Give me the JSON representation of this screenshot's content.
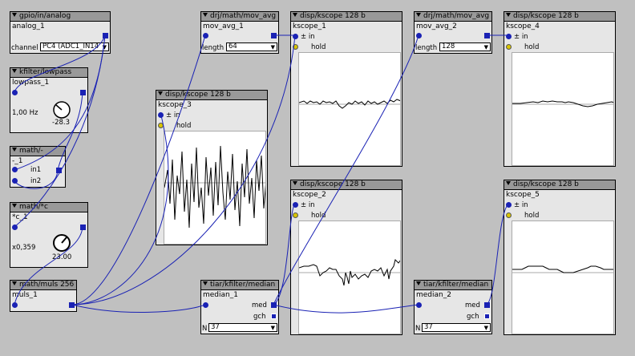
{
  "colors": {
    "background": "#c0c0c0",
    "object": "#e6e6e6",
    "header": "#999999",
    "wire": "#1a22b4",
    "bang": "#d8c400"
  },
  "gpio": {
    "title": "gpio/in/analog",
    "instance": "analog_1",
    "channel_label": "channel",
    "channel_value": "PC4 (ADC1_IN14"
  },
  "lowpass": {
    "title": "kfilter/lowpass",
    "instance": "lowpass_1",
    "value": "1,00 Hz",
    "knob_value": "-28.3"
  },
  "minus": {
    "title": "math/-",
    "instance": "-_1",
    "in1": "in1",
    "in2": "in2"
  },
  "mulc": {
    "title": "math/*c",
    "instance": "*c_1",
    "value": "x0,359",
    "knob_value": "23.00"
  },
  "muls": {
    "title": "math/muls 256",
    "instance": "muls_1"
  },
  "kscope3": {
    "title": "disp/kscope 128 b",
    "instance": "kscope_3",
    "in": "± in",
    "hold": "hold"
  },
  "movavg1": {
    "title": "drj/math/mov_avg",
    "instance": "mov_avg_1",
    "length_label": "length",
    "length_value": "64"
  },
  "kscope1": {
    "title": "disp/kscope 128 b",
    "instance": "kscope_1",
    "in": "± in",
    "hold": "hold"
  },
  "kscope2": {
    "title": "disp/kscope 128 b",
    "instance": "kscope_2",
    "in": "± in",
    "hold": "hold"
  },
  "median1": {
    "title": "tiar/kfilter/median",
    "instance": "median_1",
    "med": "med",
    "gch": "gch",
    "n_label": "N",
    "n_value": "37"
  },
  "movavg2": {
    "title": "drj/math/mov_avg",
    "instance": "mov_avg_2",
    "length_label": "length",
    "length_value": "128"
  },
  "median2": {
    "title": "tiar/kfilter/median",
    "instance": "median_2",
    "med": "med",
    "gch": "gch",
    "n_label": "N",
    "n_value": "37"
  },
  "kscope4": {
    "title": "disp/kscope 128 b",
    "instance": "kscope_4",
    "in": "± in",
    "hold": "hold"
  },
  "kscope5": {
    "title": "disp/kscope 128 b",
    "instance": "kscope_5",
    "in": "± in",
    "hold": "hold"
  }
}
